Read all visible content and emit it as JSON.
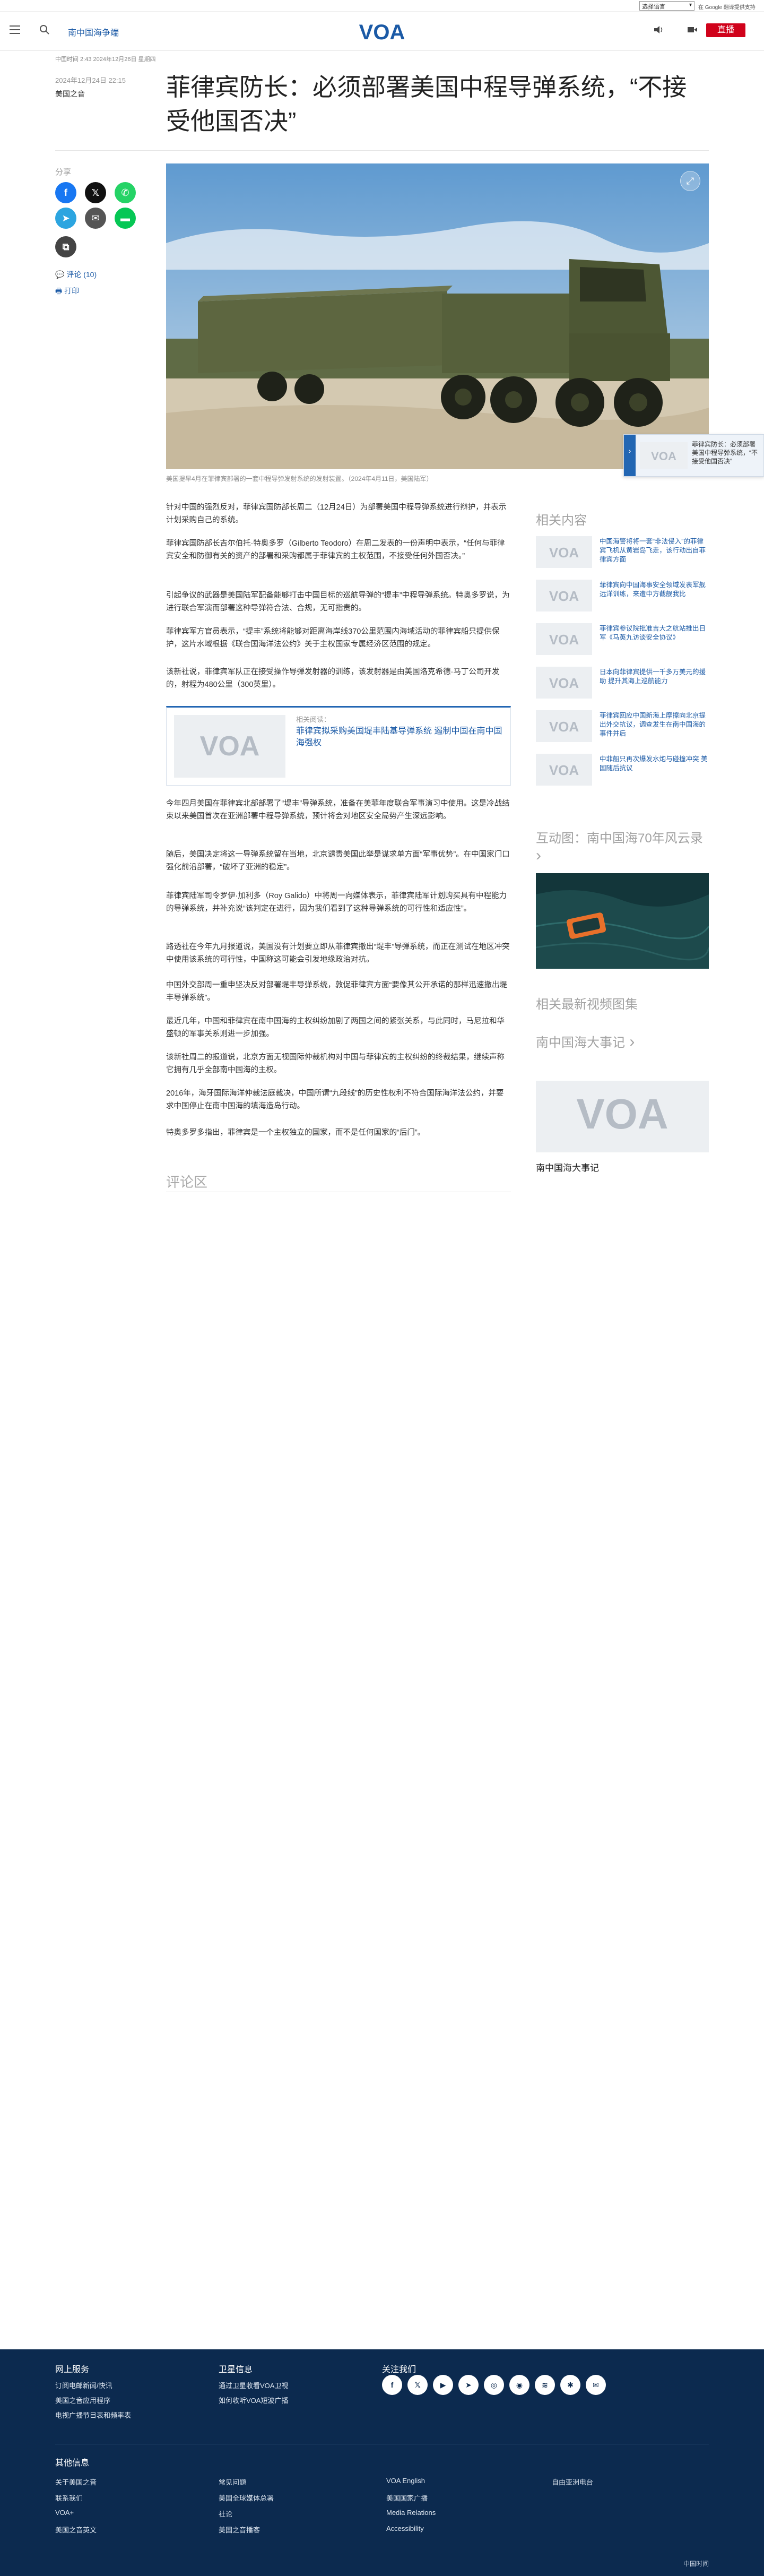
{
  "topbar": {
    "language_select": "选择语言",
    "links": "在 Google 翻译提供支持"
  },
  "header": {
    "section_link": "南中国海争端",
    "logo": "VOA",
    "live_label": "直播"
  },
  "article": {
    "time_line": "中国时间 2:43 2024年12月26日 星期四",
    "date": "2024年12月24日 22:15",
    "source": "美国之音",
    "headline": "菲律宾防长：必须部署美国中程导弹系统，“不接受他国否决”",
    "share_label": "分享",
    "comment_link": "评论 (10)",
    "print_link": "打印",
    "caption": "美国提早4月在菲律宾部署的一套中程导弹发射系统的发射装置。（2024年4月11日，美国陆军）",
    "paragraphs": [
      "针对中国的强烈反对，菲律宾国防部长周二（12月24日）为部署美国中程导弹系统进行辩护，并表示计划采购自己的系统。",
      "菲律宾国防部长吉尔伯托·特奥多罗（Gilberto Teodoro）在周二发表的一份声明中表示，“任何与菲律宾安全和防御有关的资产的部署和采购都属于菲律宾的主权范围，不接受任何外国否决。”",
      "引起争议的武器是美国陆军配备能够打击中国目标的巡航导弹的“提丰”中程导弹系统。特奥多罗说，为进行联合军演而部署这种导弹符合法、合规，无可指责的。",
      "菲律宾军方官员表示，“提丰”系统将能够对距离海岸线370公里范围内海域活动的菲律宾船只提供保护，这片水域根据《联合国海洋法公约》关于主权国家专属经济区范围的规定。",
      "该新社说，菲律宾军队正在接受操作导弹发射器的训练，该发射器是由美国洛克希德·马丁公司开发的，射程为480公里（300英里）。"
    ],
    "inline_card": {
      "label": "相关阅读：",
      "title": "菲律宾拟采购美国堤丰陆基导弹系统 遏制中国在南中国海强权"
    },
    "paragraphs2": [
      "今年四月美国在菲律宾北部部署了“堤丰”导弹系统，准备在美菲年度联合军事演习中使用。这是冷战结束以来美国首次在亚洲部署中程导弹系统，预计将会对地区安全局势产生深远影响。",
      "随后，美国决定将这一导弹系统留在当地，北京谴责美国此举是谋求单方面“军事优势”。在中国家门口强化前沿部署，“破坏了亚洲的稳定”。",
      "菲律宾陆军司令罗伊·加利多（Roy Galido）中将周一向媒体表示，菲律宾陆军计划购买具有中程能力的导弹系统，并补充说“该判定在进行，因为我们看到了这种导弹系统的可行性和适应性”。",
      "路透社在今年九月报道说，美国没有计划要立即从菲律宾撤出“堤丰”导弹系统，而正在测试在地区冲突中使用该系统的可行性，中国称这可能会引发地缘政治对抗。",
      "中国外交部周一重申坚决反对部署堤丰导弹系统，敦促菲律宾方面“要像其公开承诺的那样迅速撤出堤丰导弹系统”。",
      "最近几年，中国和菲律宾在南中国海的主权纠纷加剧了两国之间的紧张关系，与此同时，马尼拉和华盛顿的军事关系则进一步加强。",
      "该新社周二的报道说，北京方面无视国际仲裁机构对中国与菲律宾的主权纠纷的终裁结果，继续声称它拥有几乎全部南中国海的主权。",
      "2016年，海牙国际海洋仲裁法庭裁决，中国所谓“九段线”的历史性权利不符合国际海洋法公约，并要求中国停止在南中国海的填海造岛行动。",
      "特奥多罗多指出，菲律宾是一个主权独立的国家，而不是任何国家的“后门”。"
    ],
    "comments_title": "评论区"
  },
  "float_card": {
    "title": "菲律宾防长：必须部署美国中程导弹系统，“不接受他国否决”"
  },
  "sidebar": {
    "related_title": "相关内容",
    "related": [
      "中国海警将将一套“非法侵入”的菲律宾飞机从黄岩岛飞走，该行动出自菲律宾方面",
      "菲律宾向中国海事安全领域发表军舰远洋训练，来遭中方截舰我比",
      "菲律宾参议院批准吉大之航站推出日军《马英九访谈安全协议》",
      "日本向菲律宾提供一千多万美元的援助 提升其海上巡航能力",
      "菲律宾回应中国新海上摩擦向北京提出外交抗议，调查发生在南中国海的事件并后",
      "中菲船只再次爆发水炮与碰撞冲突 美国随后抗议"
    ],
    "interactive_title": "互动图：南中国海70年风云录",
    "videos_title": "相关最新视频图集",
    "timeline_title": "南中国海大事记",
    "timeline_caption": "南中国海大事记"
  },
  "footer": {
    "col1_title": "网上服务",
    "col1_links": [
      "订阅电邮新闻/快讯",
      "美国之音应用程序",
      "电视广播节目表和频率表"
    ],
    "col2_title": "卫星信息",
    "col2_links": [
      "通过卫星收看VOA卫视",
      "如何收听VOA短波广播"
    ],
    "col3_title": "关注我们",
    "other_title": "其他信息",
    "other_links_a": [
      "关于美国之音",
      "联系我们",
      "VOA+",
      "美国之音英文"
    ],
    "other_links_b": [
      "常见问题",
      "美国全球媒体总署",
      "社论",
      "美国之音播客"
    ],
    "other_links_c": [
      "VOA English",
      "美国国家广播",
      "Media Relations",
      "Accessibility"
    ],
    "other_links_d": [
      "自由亚洲电台"
    ],
    "site_footer": "中国时间"
  }
}
